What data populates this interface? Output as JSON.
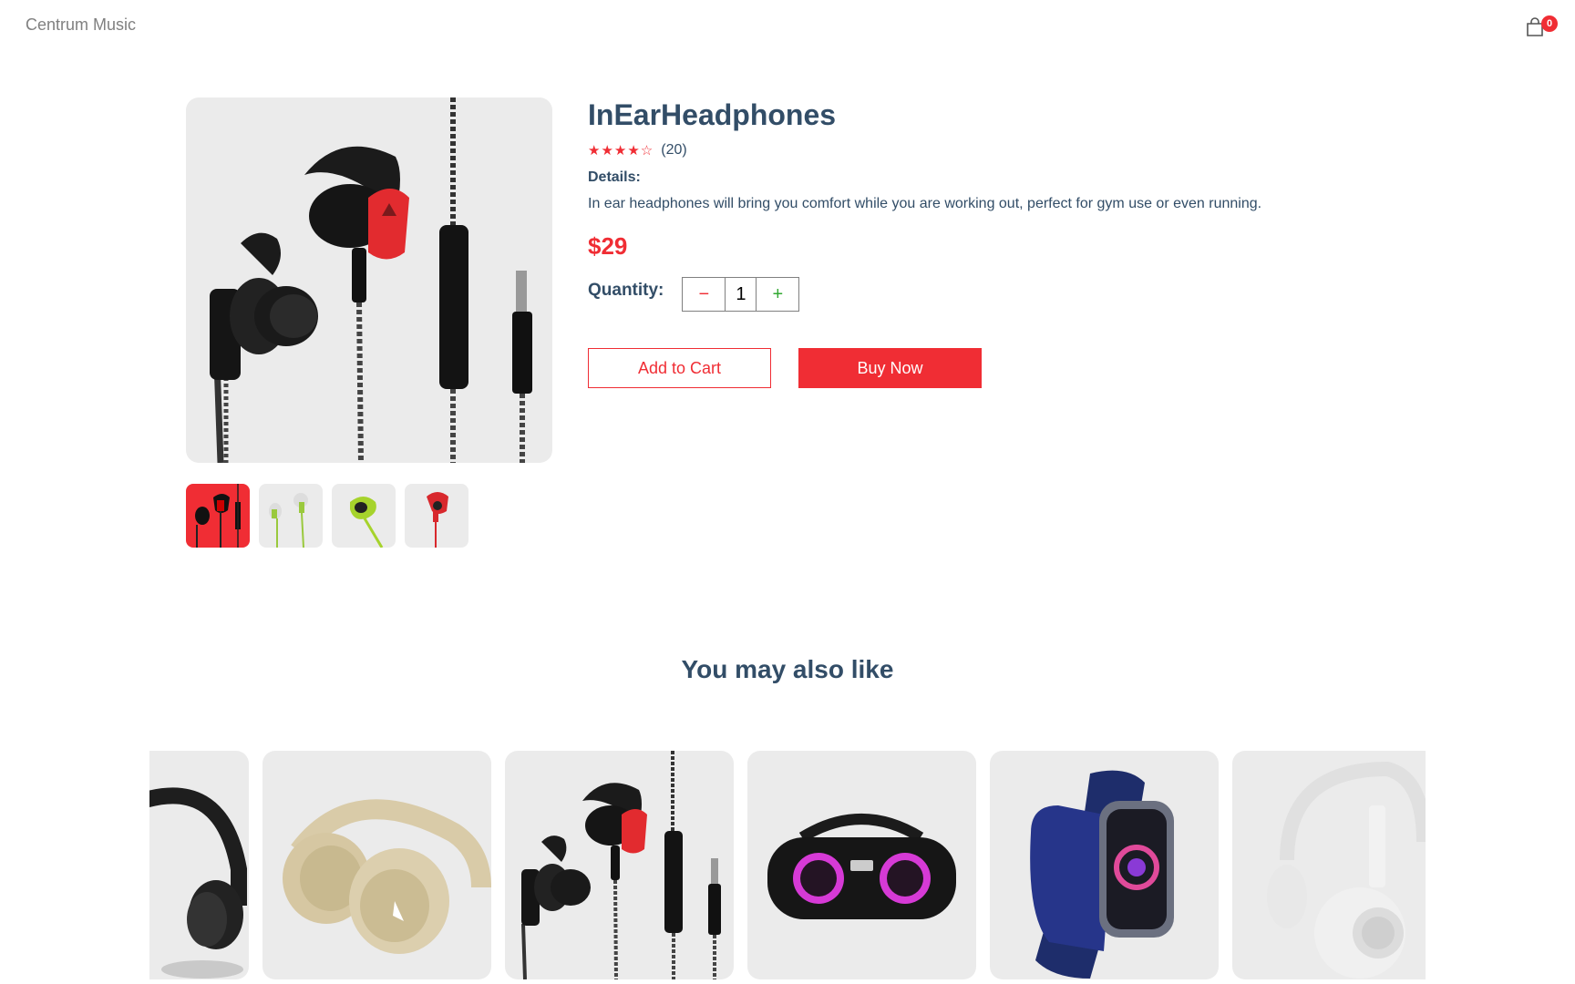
{
  "navbar": {
    "logo": "Centrum Music",
    "cart_count": "0",
    "cart_icon": "shopping-bag-icon"
  },
  "product": {
    "name": "InEarHeadphones",
    "stars": "★★★★☆",
    "rating": 4,
    "review_count": "(20)",
    "details_label": "Details:",
    "details": "In ear headphones will bring you comfort while you are working out, perfect for gym use or even running.",
    "price": "$29",
    "quantity_label": "Quantity:",
    "quantity": "1",
    "minus_symbol": "−",
    "plus_symbol": "+",
    "add_to_cart": "Add to Cart",
    "buy_now": "Buy Now",
    "thumbnails": [
      "earphones-black-red",
      "earphones-white-green",
      "earphones-green-sport",
      "earphones-red-single"
    ],
    "selected_thumbnail": 0
  },
  "recommendations": {
    "title": "You may also like",
    "items": [
      "headphones-black",
      "headphones-beige",
      "earphones-black-red",
      "boombox-speaker",
      "smartwatch-blue",
      "headphones-white"
    ]
  },
  "colors": {
    "accent": "#f02d34",
    "text": "#324d67",
    "card_bg": "#ebebeb",
    "plus": "#31a831"
  }
}
